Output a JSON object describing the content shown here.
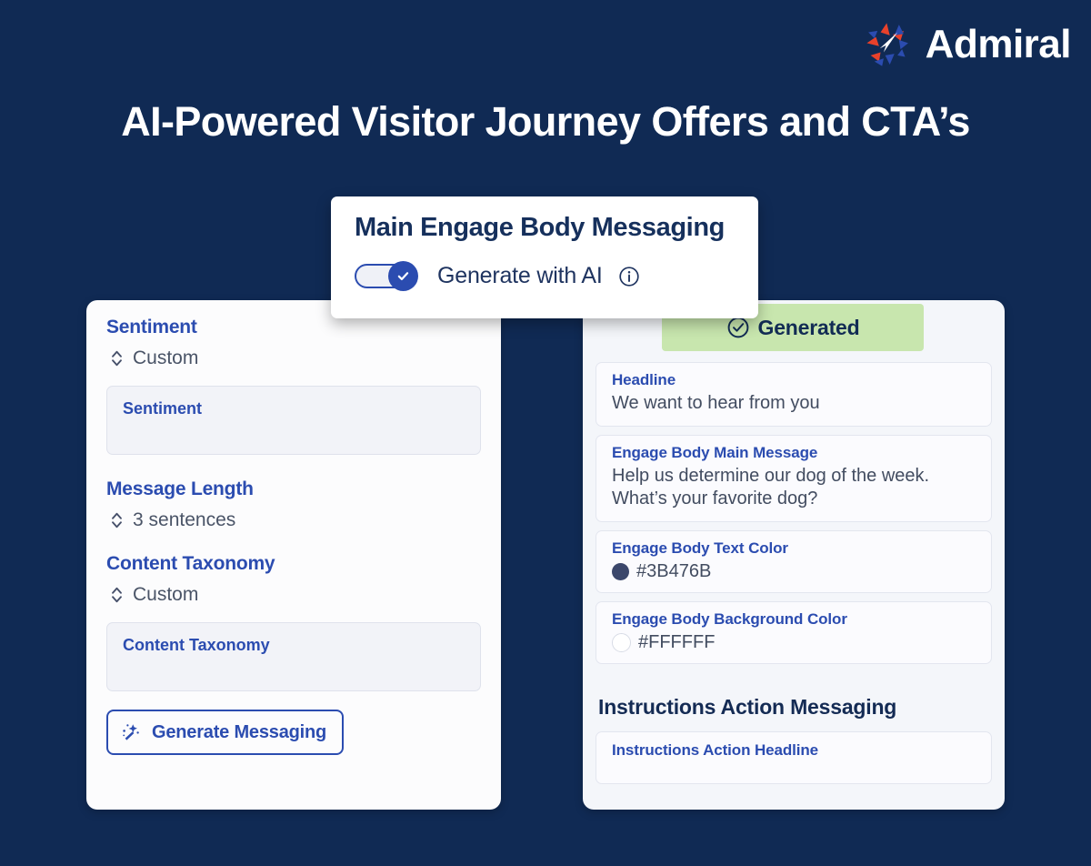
{
  "brand": {
    "name": "Admiral",
    "logo_icon": "admiral-pinwheel-logo",
    "navy": "#102A54",
    "blue": "#2B4CB0",
    "green": "#C8E6AE"
  },
  "page_title": "AI-Powered Visitor Journey Offers and CTA’s",
  "popup": {
    "title": "Main Engage Body Messaging",
    "toggle_label": "Generate with AI",
    "toggle_state": "on",
    "toggle_icon": "check-icon",
    "info_icon": "info-circle-icon"
  },
  "left_panel": {
    "sentiment": {
      "label": "Sentiment",
      "select_value": "Custom",
      "select_icon": "chevron-up-down-icon",
      "textarea_placeholder": "Sentiment"
    },
    "message_length": {
      "label": "Message Length",
      "select_value": "3 sentences",
      "select_icon": "chevron-up-down-icon"
    },
    "content_taxonomy": {
      "label": "Content Taxonomy",
      "select_value": "Custom",
      "select_icon": "chevron-up-down-icon",
      "textarea_placeholder": "Content Taxonomy"
    },
    "generate_button": {
      "label": "Generate Messaging",
      "icon": "magic-wand-icon"
    }
  },
  "right_panel": {
    "badge": {
      "label": "Generated",
      "icon": "check-circle-icon"
    },
    "fields": [
      {
        "label": "Headline",
        "value": "We want to hear from you"
      },
      {
        "label": "Engage Body Main Message",
        "value": "Help us determine our dog of the week.\nWhat’s your favorite dog?"
      },
      {
        "label": "Engage Body Text Color",
        "value": "#3B476B",
        "swatch": "#3B476B"
      },
      {
        "label": "Engage Body Background Color",
        "value": "#FFFFFF",
        "swatch": "#FFFFFF"
      }
    ],
    "section_heading": "Instructions Action Messaging",
    "instructions_field_label": "Instructions Action Headline"
  }
}
